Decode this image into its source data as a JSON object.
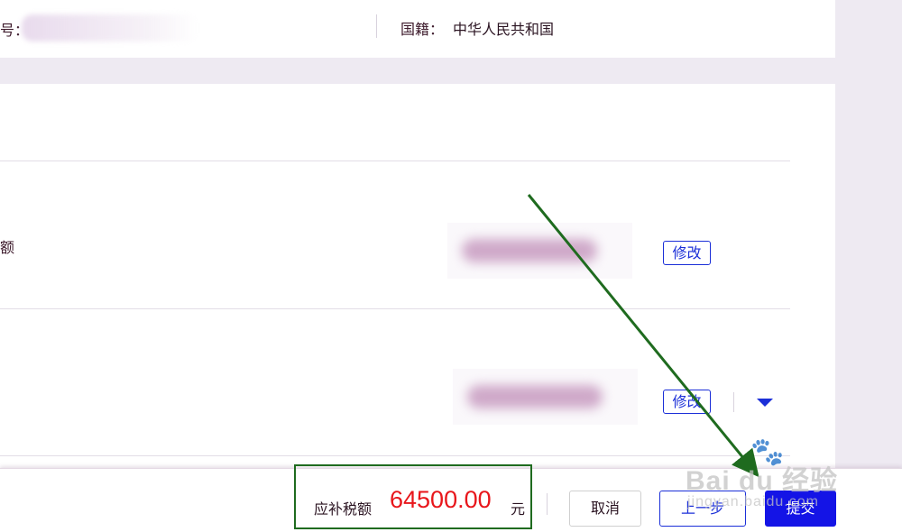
{
  "header": {
    "id_label_fragment": "号：",
    "nationality_label": "国籍：",
    "nationality_value": "中华人民共和国"
  },
  "rows": [
    {
      "label_fragment": "额",
      "edit_label": "修改"
    },
    {
      "label_fragment": "",
      "edit_label": "修改"
    }
  ],
  "footer": {
    "tax_label": "应补税额",
    "tax_amount": "64500.00",
    "tax_unit": "元",
    "cancel_label": "取消",
    "prev_label": "上一步",
    "submit_label": "提交"
  },
  "watermark": {
    "main": "Bai du 经验",
    "sub": "jingyan.baidu.com"
  },
  "colors": {
    "accent_blue": "#1b2fd8",
    "submit_blue": "#1414e6",
    "amount_red": "#e8161b",
    "annotation_green": "#1f6b1f"
  },
  "icons": {
    "expand": "caret-down-icon",
    "annotation": "arrow-icon",
    "watermark_logo": "paw-icon"
  }
}
